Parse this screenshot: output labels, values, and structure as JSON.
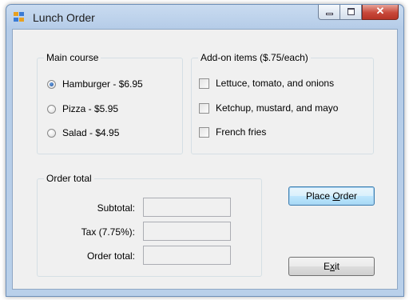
{
  "window": {
    "title": "Lunch Order"
  },
  "main_course": {
    "label": "Main course",
    "options": [
      {
        "label": "Hamburger - $6.95",
        "selected": true
      },
      {
        "label": "Pizza - $5.95",
        "selected": false
      },
      {
        "label": "Salad - $4.95",
        "selected": false
      }
    ]
  },
  "addons": {
    "label": "Add-on items ($.75/each)",
    "items": [
      {
        "label": "Lettuce, tomato, and onions",
        "checked": false
      },
      {
        "label": "Ketchup, mustard, and mayo",
        "checked": false
      },
      {
        "label": "French fries",
        "checked": false
      }
    ]
  },
  "order_total": {
    "label": "Order total",
    "rows": [
      {
        "label": "Subtotal:",
        "value": ""
      },
      {
        "label": "Tax (7.75%):",
        "value": ""
      },
      {
        "label": "Order total:",
        "value": ""
      }
    ]
  },
  "buttons": {
    "place_order": {
      "pre": "Place ",
      "accel": "O",
      "post": "rder"
    },
    "exit": {
      "pre": "E",
      "accel": "x",
      "post": "it"
    }
  },
  "icons": {
    "app": "app-window-icon",
    "minimize": "minimize-icon",
    "maximize": "maximize-icon",
    "close": "close-icon"
  }
}
